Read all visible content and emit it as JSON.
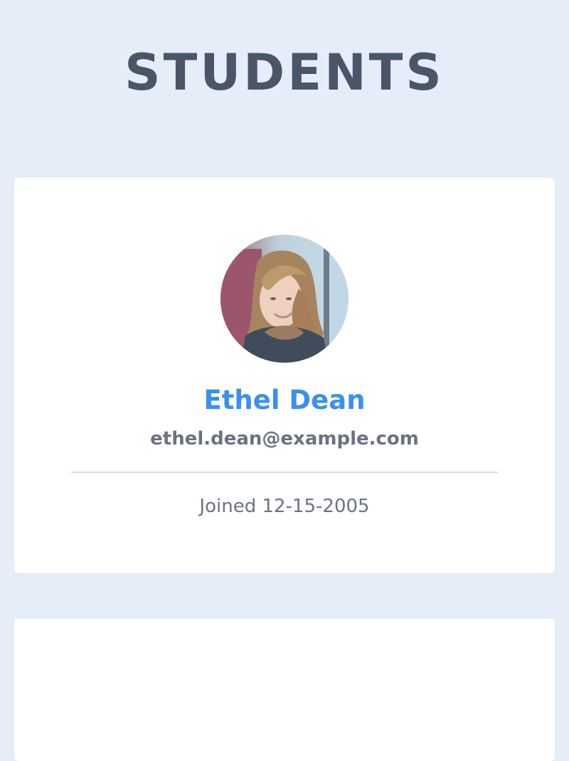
{
  "page": {
    "title": "STUDENTS"
  },
  "students": [
    {
      "name": "Ethel Dean",
      "email": "ethel.dean@example.com",
      "joined": "Joined 12-15-2005",
      "avatar_alt": "Ethel Dean avatar"
    }
  ],
  "colors": {
    "background": "#e5edf9",
    "card": "#ffffff",
    "title": "#4a5568",
    "name": "#3b8fef",
    "secondary_text": "#6b7280",
    "divider": "#dddddd"
  }
}
